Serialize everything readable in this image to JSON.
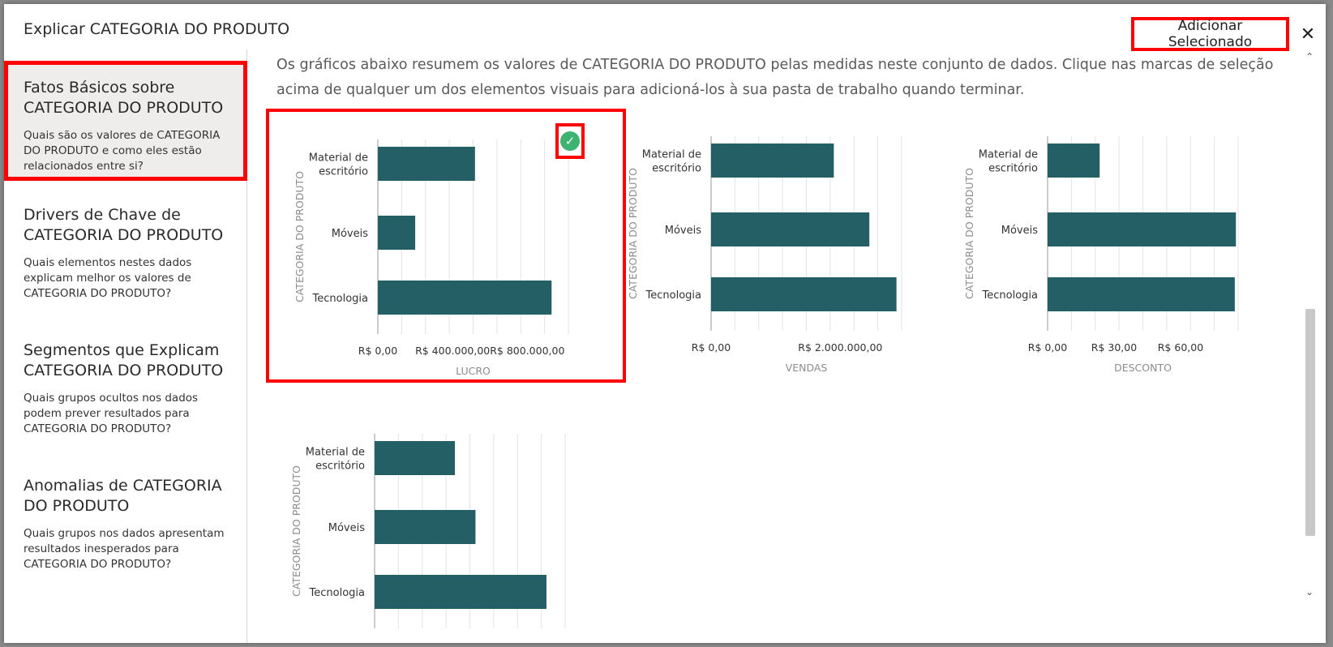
{
  "dialog": {
    "title": "Explicar CATEGORIA DO PRODUTO",
    "add_selected_label": "Adicionar Selecionado",
    "close_glyph": "✕"
  },
  "sidebar": {
    "items": [
      {
        "title": "Fatos Básicos sobre CATEGORIA DO PRODUTO",
        "desc": "Quais são os valores de CATEGORIA DO PRODUTO e como eles estão relacionados entre si?",
        "active": true
      },
      {
        "title": "Drivers de Chave de CATEGORIA DO PRODUTO",
        "desc": "Quais elementos nestes dados explicam melhor os valores de CATEGORIA DO PRODUTO?",
        "active": false
      },
      {
        "title": "Segmentos que Explicam CATEGORIA DO PRODUTO",
        "desc": "Quais grupos ocultos nos dados podem prever resultados para CATEGORIA DO PRODUTO?",
        "active": false
      },
      {
        "title": "Anomalias de CATEGORIA DO PRODUTO",
        "desc": "Quais grupos nos dados apresentam resultados inesperados para CATEGORIA DO PRODUTO?",
        "active": false
      }
    ]
  },
  "main": {
    "intro": "Os gráficos abaixo resumem os valores de CATEGORIA DO PRODUTO pelas medidas neste conjunto de dados. Clique nas marcas de seleção acima de qualquer um dos elementos visuais para adicioná-los à sua pasta de trabalho quando terminar."
  },
  "colors": {
    "bar": "#245f66",
    "highlight": "#ff0000",
    "check": "#3cb371"
  },
  "icons": {
    "check": "check-circle-icon",
    "close": "close-icon"
  },
  "chart_data": [
    {
      "type": "bar",
      "orientation": "horizontal",
      "categories": [
        "Material de escritório",
        "Móveis",
        "Tecnologia"
      ],
      "values": [
        520000,
        200000,
        930000
      ],
      "xlabel": "LUCRO",
      "ylabel": "CATEGORIA DO PRODUTO",
      "ticks": [
        "R$ 0,00",
        "R$ 400.000,00",
        "R$ 800.000,00"
      ],
      "tick_values": [
        0,
        400000,
        800000
      ],
      "xlim": [
        0,
        1020000
      ],
      "selected": true
    },
    {
      "type": "bar",
      "orientation": "horizontal",
      "categories": [
        "Material de escritório",
        "Móveis",
        "Tecnologia"
      ],
      "values": [
        1900000,
        2450000,
        2870000
      ],
      "xlabel": "VENDAS",
      "ylabel": "CATEGORIA DO PRODUTO",
      "ticks": [
        "R$ 0,00",
        "R$ 2.000.000,00"
      ],
      "tick_values": [
        0,
        2000000
      ],
      "xlim": [
        0,
        2950000
      ],
      "selected": false
    },
    {
      "type": "bar",
      "orientation": "horizontal",
      "categories": [
        "Material de escritório",
        "Móveis",
        "Tecnologia"
      ],
      "values": [
        23.5,
        85,
        84.5
      ],
      "xlabel": "DESCONTO",
      "ylabel": "CATEGORIA DO PRODUTO",
      "ticks": [
        "R$ 0,00",
        "R$ 30,00",
        "R$ 60,00"
      ],
      "tick_values": [
        0,
        30,
        60
      ],
      "xlim": [
        0,
        86
      ],
      "selected": false
    },
    {
      "type": "bar",
      "orientation": "horizontal",
      "categories": [
        "Material de escritório",
        "Móveis",
        "Tecnologia"
      ],
      "values": [
        430,
        540,
        920
      ],
      "xlabel": "",
      "ylabel": "CATEGORIA DO PRODUTO",
      "ticks": [],
      "tick_values": [],
      "xlim": [
        0,
        1020
      ],
      "selected": false
    }
  ]
}
